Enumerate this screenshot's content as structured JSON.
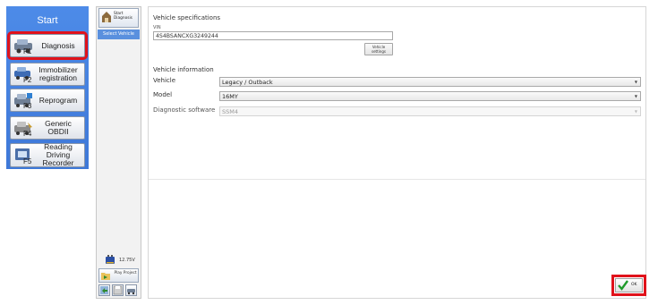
{
  "start_panel": {
    "title": "Start",
    "buttons": [
      {
        "label": "Diagnosis",
        "key": "F1",
        "selected": true
      },
      {
        "label": "Immobilizer registration",
        "key": "F2"
      },
      {
        "label": "Reprogram",
        "key": "F3"
      },
      {
        "label": "Generic OBDII",
        "key": "F4"
      },
      {
        "label": "Reading Driving Recorder",
        "key": "F5"
      }
    ]
  },
  "nav": {
    "start_tab_label": "Start Diagnosis",
    "select_vehicle_label": "Select Vehicle",
    "voltage": "12.75V",
    "play_project_label": "Play Project"
  },
  "main": {
    "spec_title": "Vehicle specifications",
    "vin_label": "VIN",
    "vin_value": "4S4BSANCXG3249244",
    "vehicle_settings_label": "Vehicle settings",
    "info_title": "Vehicle information",
    "fields": [
      {
        "label": "Vehicle",
        "value": "Legacy / Outback",
        "enabled": true
      },
      {
        "label": "Model",
        "value": "16MY",
        "enabled": true
      },
      {
        "label": "Diagnostic software",
        "value": "SSM4",
        "enabled": false
      }
    ],
    "ok_label": "OK"
  },
  "colors": {
    "start_panel_bg": "#4a86e8",
    "highlight_red": "#e0121b",
    "select_vehicle_bg": "#5a90de"
  }
}
